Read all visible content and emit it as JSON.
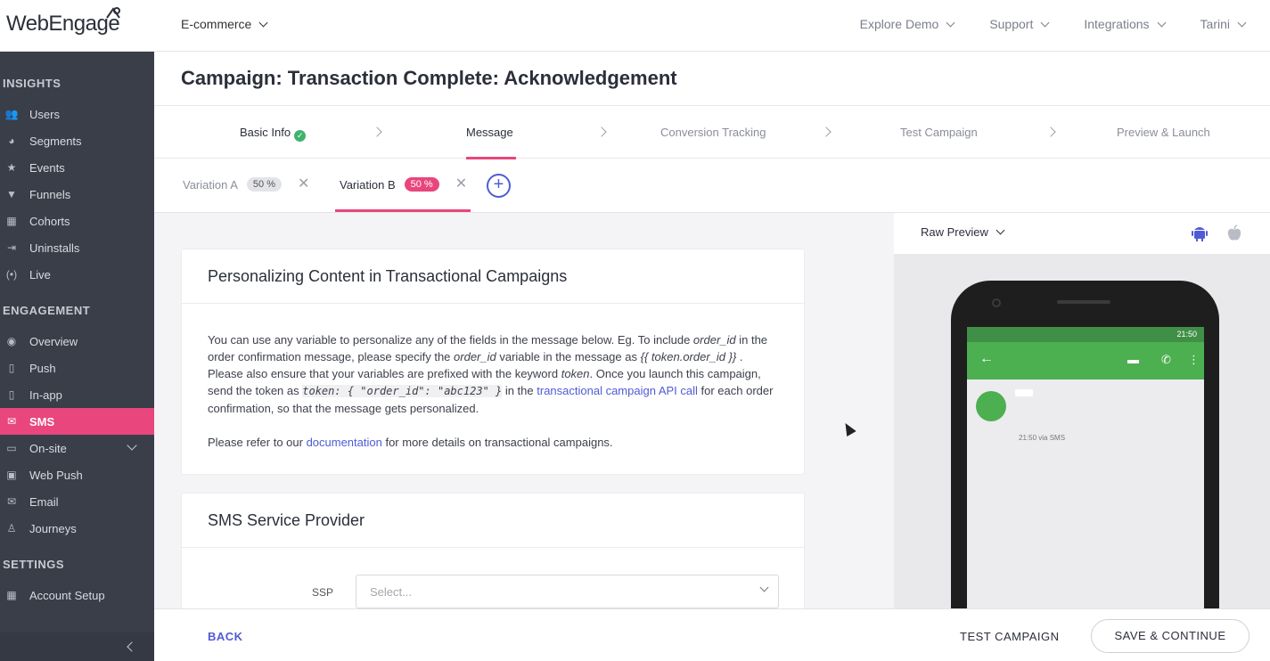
{
  "brand": {
    "logo_text": "WebEngage",
    "accent": "#e8467c",
    "link_color": "#4f5bd5",
    "sidebar_bg": "#3a3e49"
  },
  "topbar": {
    "project": "E-commerce",
    "nav": [
      "Explore Demo",
      "Support",
      "Integrations",
      "Tarini"
    ]
  },
  "sidebar": {
    "sections": [
      "INSIGHTS",
      "ENGAGEMENT",
      "SETTINGS"
    ],
    "insights": [
      {
        "label": "Users",
        "icon": "users-icon"
      },
      {
        "label": "Segments",
        "icon": "pie-icon"
      },
      {
        "label": "Events",
        "icon": "star-icon"
      },
      {
        "label": "Funnels",
        "icon": "funnel-icon"
      },
      {
        "label": "Cohorts",
        "icon": "grid-icon"
      },
      {
        "label": "Uninstalls",
        "icon": "exit-icon"
      },
      {
        "label": "Live",
        "icon": "broadcast-icon"
      }
    ],
    "engagement": [
      {
        "label": "Overview",
        "icon": "eye-icon"
      },
      {
        "label": "Push",
        "icon": "mobile-icon"
      },
      {
        "label": "In-app",
        "icon": "mobile-icon"
      },
      {
        "label": "SMS",
        "icon": "sms-icon"
      },
      {
        "label": "On-site",
        "icon": "window-icon"
      },
      {
        "label": "Web Push",
        "icon": "webpush-icon"
      },
      {
        "label": "Email",
        "icon": "email-icon"
      },
      {
        "label": "Journeys",
        "icon": "journey-icon"
      }
    ],
    "settings": [
      {
        "label": "Account Setup",
        "icon": "grid-icon"
      }
    ],
    "active": "SMS"
  },
  "page": {
    "title": "Campaign: Transaction Complete: Acknowledgement",
    "steps": [
      "Basic Info",
      "Message",
      "Conversion Tracking",
      "Test Campaign",
      "Preview & Launch"
    ],
    "active_step": "Message"
  },
  "variations": [
    {
      "label": "Variation A",
      "percent": "50 %"
    },
    {
      "label": "Variation B",
      "percent": "50 %"
    }
  ],
  "personalize_card": {
    "title": "Personalizing Content in Transactional Campaigns",
    "p1_a": "You can use any variable to personalize any of the fields in the message below. Eg. To include ",
    "p1_order_id": "order_id",
    "p1_b": " in the order confirmation message, please specify the ",
    "p1_c": " variable in the message as ",
    "p1_token_expr": "{{ token.order_id }}",
    "p1_d": " . Please also ensure that your variables are prefixed with the keyword ",
    "p1_token": "token",
    "p1_e": ". Once you launch this campaign, send the token as ",
    "p1_code": "token: { \"order_id\": \"abc123\" }",
    "p1_f": " in the ",
    "p1_link": "transactional campaign API call",
    "p1_g": " for each order confirmation, so that the message gets personalized.",
    "p2_a": "Please refer to our ",
    "p2_link": "documentation",
    "p2_b": " for more details on transactional campaigns."
  },
  "ssp_card": {
    "title": "SMS Service Provider",
    "label": "SSP",
    "placeholder": "Select..."
  },
  "preview": {
    "mode": "Raw Preview",
    "status_time": "21:50",
    "msg_meta": "21:50 via SMS"
  },
  "footer": {
    "back": "BACK",
    "test": "TEST CAMPAIGN",
    "save": "SAVE & CONTINUE"
  }
}
